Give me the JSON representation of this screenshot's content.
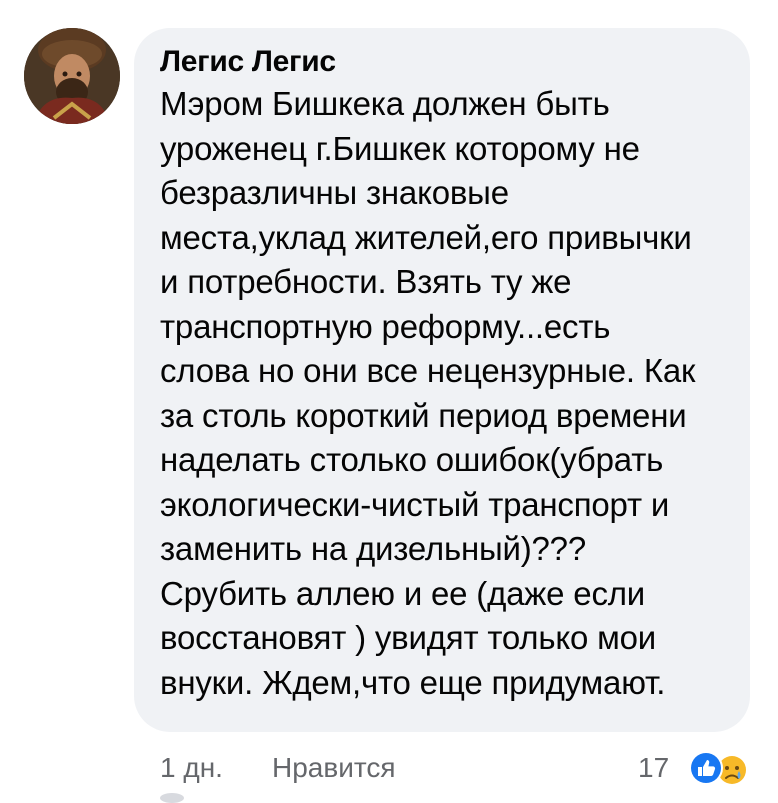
{
  "comment": {
    "author": "Легис Легис",
    "text_lines": [
      "Мэром Бишкека должен быть",
      "уроженец г.Бишкек которому не",
      "безразличны знаковые",
      "места,уклад жителей,его привычки",
      "и потребности. Взять ту же",
      "транспортную реформу...есть",
      "слова но они все нецензурные. Как",
      "за столь короткий период времени",
      "наделать столько ошибок(убрать",
      "экологически-чистый транспорт и",
      "заменить на дизельный)???",
      "Срубить аллею и ее (даже если",
      "восстановят ) увидят только мои",
      "внуки. Ждем,что еще придумают."
    ],
    "time": "1 дн.",
    "like_label": "Нравится",
    "reaction_count": "17",
    "reactions": [
      "like-icon",
      "sad-icon"
    ]
  },
  "colors": {
    "bubble": "#f0f2f5",
    "text": "#050505",
    "meta": "#65676b",
    "like_blue": "#1877f2",
    "sad_yellow": "#f7b928"
  }
}
